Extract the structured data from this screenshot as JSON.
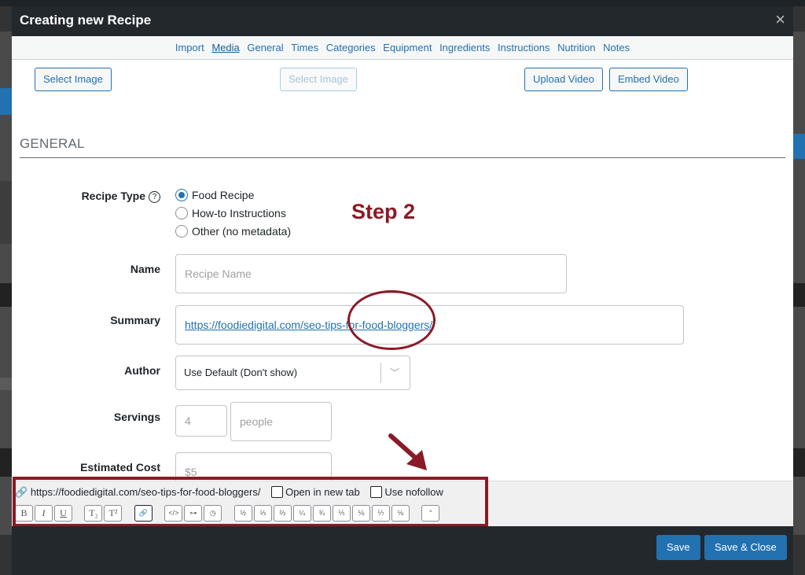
{
  "modal": {
    "title": "Creating new Recipe",
    "close_glyph": "×"
  },
  "tabs": [
    {
      "label": "Import"
    },
    {
      "label": "Media",
      "active": true
    },
    {
      "label": "General"
    },
    {
      "label": "Times"
    },
    {
      "label": "Categories"
    },
    {
      "label": "Equipment"
    },
    {
      "label": "Ingredients"
    },
    {
      "label": "Instructions"
    },
    {
      "label": "Nutrition"
    },
    {
      "label": "Notes"
    }
  ],
  "media": {
    "select_image_label": "Select Image",
    "select_image_disabled_label": "Select Image",
    "upload_video_label": "Upload Video",
    "embed_video_label": "Embed Video"
  },
  "general": {
    "section_title": "GENERAL",
    "recipe_type": {
      "label": "Recipe Type",
      "help_glyph": "?",
      "options": [
        {
          "label": "Food Recipe",
          "checked": true
        },
        {
          "label": "How-to Instructions",
          "checked": false
        },
        {
          "label": "Other (no metadata)",
          "checked": false
        }
      ]
    },
    "name": {
      "label": "Name",
      "placeholder": "Recipe Name"
    },
    "summary": {
      "label": "Summary",
      "value": "https://foodiedigital.com/seo-tips-for-food-bloggers/"
    },
    "author": {
      "label": "Author",
      "value": "Use Default (Don't show)",
      "chevron": "﹀"
    },
    "servings": {
      "label": "Servings",
      "placeholder": "4",
      "unit_placeholder": "people"
    },
    "estimated_cost": {
      "label": "Estimated Cost",
      "placeholder": "$5"
    }
  },
  "annotation": {
    "step_text": "Step 2",
    "color": "#8b1a26"
  },
  "link_toolbar": {
    "url": "https://foodiedigital.com/seo-tips-for-food-bloggers/",
    "open_new_tab_label": "Open in new tab",
    "nofollow_label": "Use nofollow",
    "buttons": {
      "bold": "B",
      "italic": "I",
      "underline": "U",
      "subscript": "T₂",
      "superscript": "T²",
      "link": "🔗",
      "code": "</>",
      "adjust": "⊶",
      "timer": "◷",
      "half": "½",
      "third": "⅓",
      "two_thirds": "⅔",
      "quarter": "¼",
      "three_quarters": "¾",
      "fifth": "⅕",
      "sixth": "⅙",
      "seventh": "⅐",
      "eighth": "⅛",
      "degree": "°"
    }
  },
  "footer": {
    "save_label": "Save",
    "save_close_label": "Save & Close"
  },
  "colors": {
    "primary": "#2271b1",
    "header_bg": "#23282d",
    "annotation": "#8b1a26"
  }
}
